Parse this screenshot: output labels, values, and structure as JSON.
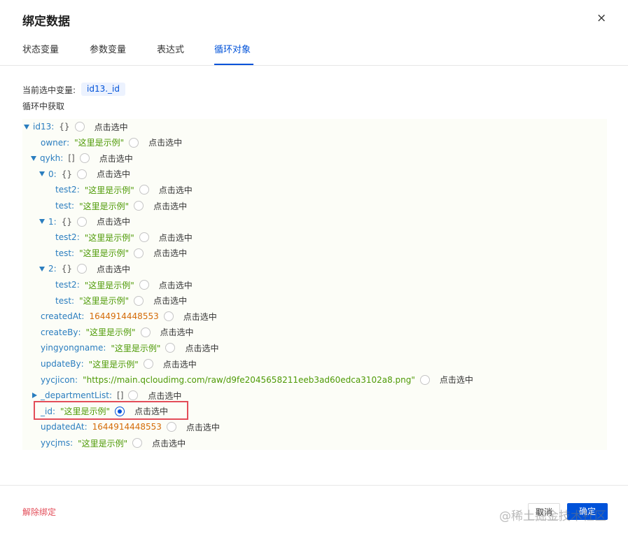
{
  "dialog": {
    "title": "绑定数据",
    "close": "×"
  },
  "tabs": [
    "状态变量",
    "参数变量",
    "表达式",
    "循环对象"
  ],
  "current": {
    "label": "当前选中变量:",
    "value": "id13._id"
  },
  "loop_label": "循环中获取",
  "pick_text": "点击选中",
  "tree": [
    {
      "key": "id13",
      "val": "{}",
      "type": "brace",
      "arrow": "down"
    },
    {
      "key": "owner",
      "val": "\"这里是示例\"",
      "type": "str",
      "arrow": ""
    },
    {
      "key": "qykh",
      "val": "[]",
      "type": "brace",
      "arrow": "down"
    },
    {
      "key": "0",
      "val": "{}",
      "type": "brace",
      "arrow": "down"
    },
    {
      "key": "test2",
      "val": "\"这里是示例\"",
      "type": "str",
      "arrow": ""
    },
    {
      "key": "test",
      "val": "\"这里是示例\"",
      "type": "str",
      "arrow": ""
    },
    {
      "key": "1",
      "val": "{}",
      "type": "brace",
      "arrow": "down"
    },
    {
      "key": "test2",
      "val": "\"这里是示例\"",
      "type": "str",
      "arrow": ""
    },
    {
      "key": "test",
      "val": "\"这里是示例\"",
      "type": "str",
      "arrow": ""
    },
    {
      "key": "2",
      "val": "{}",
      "type": "brace",
      "arrow": "down"
    },
    {
      "key": "test2",
      "val": "\"这里是示例\"",
      "type": "str",
      "arrow": ""
    },
    {
      "key": "test",
      "val": "\"这里是示例\"",
      "type": "str",
      "arrow": ""
    },
    {
      "key": "createdAt",
      "val": "1644914448553",
      "type": "num",
      "arrow": ""
    },
    {
      "key": "createBy",
      "val": "\"这里是示例\"",
      "type": "str",
      "arrow": ""
    },
    {
      "key": "yingyongname",
      "val": "\"这里是示例\"",
      "type": "str",
      "arrow": ""
    },
    {
      "key": "updateBy",
      "val": "\"这里是示例\"",
      "type": "str",
      "arrow": ""
    },
    {
      "key": "yycjicon",
      "val": "\"https://main.qcloudimg.com/raw/d9fe2045658211eeb3ad60edca3102a8.png\"",
      "type": "str",
      "arrow": ""
    },
    {
      "key": "_departmentList",
      "val": "[]",
      "type": "brace",
      "arrow": "right"
    },
    {
      "key": "_id",
      "val": "\"这里是示例\"",
      "type": "str",
      "arrow": "",
      "checked": true
    },
    {
      "key": "updatedAt",
      "val": "1644914448553",
      "type": "num",
      "arrow": ""
    },
    {
      "key": "yycjms",
      "val": "\"这里是示例\"",
      "type": "str",
      "arrow": ""
    }
  ],
  "footer": {
    "unbind": "解除绑定",
    "cancel": "取消",
    "ok": "确定"
  },
  "watermark": "@稀土掘金技术社区"
}
